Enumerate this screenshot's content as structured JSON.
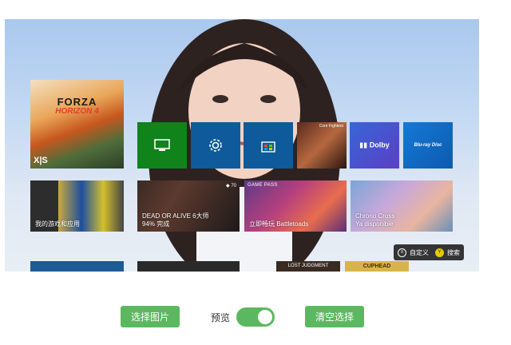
{
  "tiles": {
    "forza": {
      "title": "FORZA",
      "subtitle": "HORIZON 4",
      "platform": "X|S"
    },
    "my_games": {
      "label": "我的游戏和应用"
    },
    "doa": {
      "title": "DEAD OR ALIVE 6大师",
      "progress": "94% 完成",
      "achievement_count": "70"
    },
    "battletoads": {
      "badge": "GAME PASS",
      "label": "立即畅玩 Battletoads"
    },
    "chrono": {
      "title": "Chrono Cross",
      "status": "Ya disponible"
    },
    "dolby": {
      "label": "Dolby"
    },
    "bluray": {
      "label": "Blu-ray Disc"
    },
    "fighters": {
      "label": "Core Fighters"
    },
    "bottom": {
      "b3": "LOST JUDGMENT",
      "b4": "CUPHEAD"
    }
  },
  "hint_bar": {
    "customize": "自定义",
    "search": "搜索",
    "customize_key": "≡",
    "search_key": "Y"
  },
  "controls": {
    "select_image": "选择图片",
    "preview": "预览",
    "clear": "清空选择"
  },
  "colors": {
    "xbox_green": "#10831a",
    "tile_blue": "#0f5a9a",
    "button_green": "#5cb860"
  },
  "icons": [
    "tv-icon",
    "gear-icon",
    "store-icon",
    "dolby-icon",
    "bluray-icon"
  ]
}
